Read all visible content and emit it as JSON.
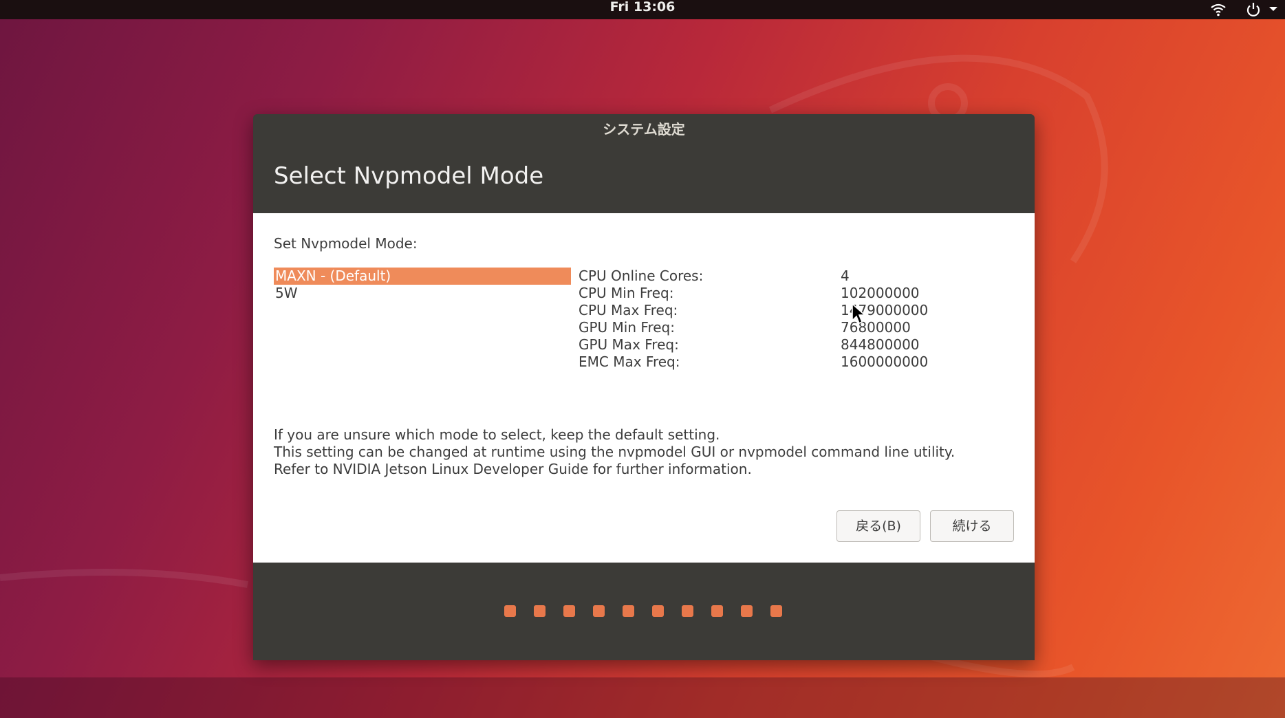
{
  "topbar": {
    "clock": "Fri 13:06",
    "icons": [
      "wifi-icon",
      "power-icon",
      "chevron-down-icon"
    ]
  },
  "dialog": {
    "window_title": "システム設定",
    "header": "Select Nvpmodel Mode",
    "set_label": "Set Nvpmodel Mode:",
    "modes": [
      {
        "label": "MAXN - (Default)",
        "selected": true
      },
      {
        "label": "5W",
        "selected": false
      }
    ],
    "specs": [
      {
        "label": "CPU Online Cores:",
        "value": "4"
      },
      {
        "label": "CPU Min Freq:",
        "value": "102000000"
      },
      {
        "label": "CPU Max Freq:",
        "value": "1479000000"
      },
      {
        "label": "GPU Min Freq:",
        "value": "76800000"
      },
      {
        "label": "GPU Max Freq:",
        "value": "844800000"
      },
      {
        "label": "EMC Max Freq:",
        "value": "1600000000"
      }
    ],
    "info_lines": [
      "If you are unsure which mode to select, keep the default setting.",
      "This setting can be changed at runtime using the nvpmodel GUI or nvpmodel command line utility.",
      "Refer to NVIDIA Jetson Linux Developer Guide for further information."
    ],
    "buttons": {
      "back": "戻る(B)",
      "continue": "続ける"
    },
    "progress": {
      "total_steps": 10,
      "color": "#e8784b"
    }
  },
  "colors": {
    "accent": "#ef8b5a",
    "dialog_dark": "#3c3b37",
    "topbar": "#1a0f10"
  }
}
